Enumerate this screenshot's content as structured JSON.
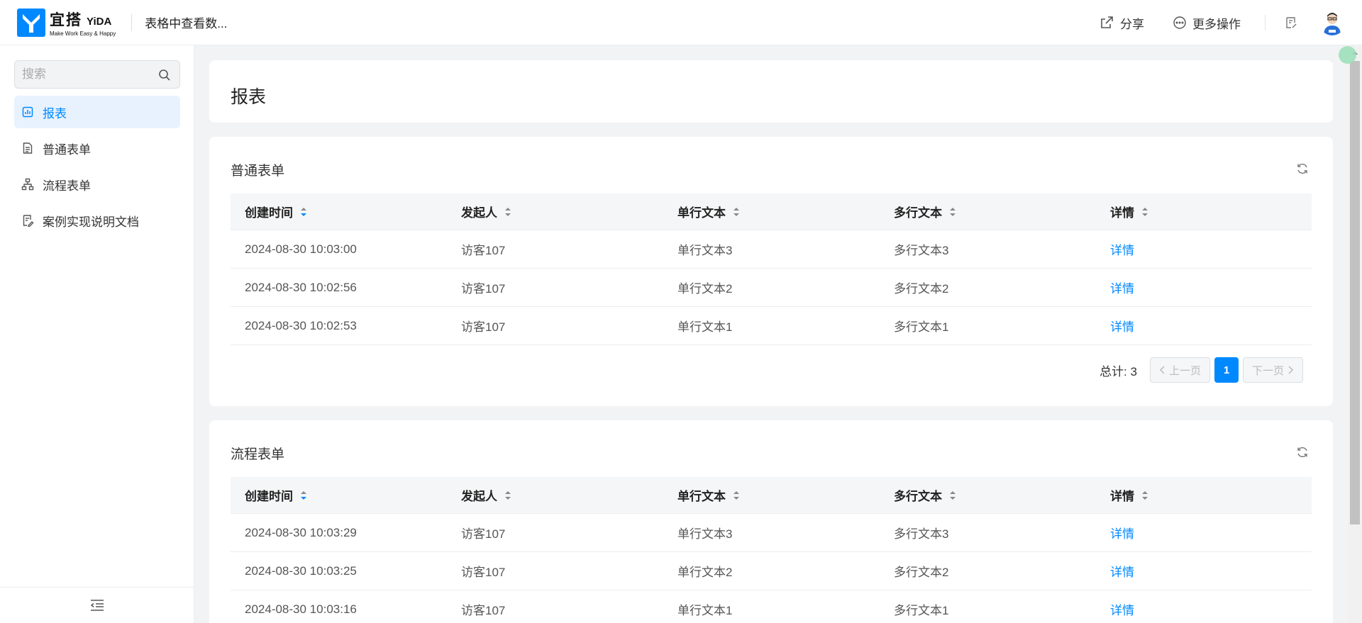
{
  "header": {
    "logo_cn": "宜搭",
    "logo_en": "YiDA",
    "logo_slogan": "Make Work Easy & Happy",
    "app_title": "表格中查看数...",
    "share_label": "分享",
    "more_label": "更多操作"
  },
  "sidebar": {
    "search_placeholder": "搜索",
    "items": [
      {
        "label": "报表",
        "icon": "report-icon",
        "active": true
      },
      {
        "label": "普通表单",
        "icon": "form-icon",
        "active": false
      },
      {
        "label": "流程表单",
        "icon": "flow-icon",
        "active": false
      },
      {
        "label": "案例实现说明文档",
        "icon": "doc-icon",
        "active": false
      }
    ]
  },
  "main": {
    "page_title": "报表",
    "columns": [
      "创建时间",
      "发起人",
      "单行文本",
      "多行文本",
      "详情"
    ],
    "sections": [
      {
        "title": "普通表单",
        "rows": [
          [
            "2024-08-30 10:03:00",
            "访客107",
            "单行文本3",
            "多行文本3",
            "详情"
          ],
          [
            "2024-08-30 10:02:56",
            "访客107",
            "单行文本2",
            "多行文本2",
            "详情"
          ],
          [
            "2024-08-30 10:02:53",
            "访客107",
            "单行文本1",
            "多行文本1",
            "详情"
          ]
        ],
        "pagination": {
          "total": "总计: 3",
          "prev": "上一页",
          "page": "1",
          "next": "下一页"
        }
      },
      {
        "title": "流程表单",
        "rows": [
          [
            "2024-08-30 10:03:29",
            "访客107",
            "单行文本3",
            "多行文本3",
            "详情"
          ],
          [
            "2024-08-30 10:03:25",
            "访客107",
            "单行文本2",
            "多行文本2",
            "详情"
          ],
          [
            "2024-08-30 10:03:16",
            "访客107",
            "单行文本1",
            "多行文本1",
            "详情"
          ]
        ]
      }
    ]
  },
  "colors": {
    "accent": "#0089ff",
    "active_bg": "#e8f2ff",
    "page_bg": "#f2f3f5"
  }
}
